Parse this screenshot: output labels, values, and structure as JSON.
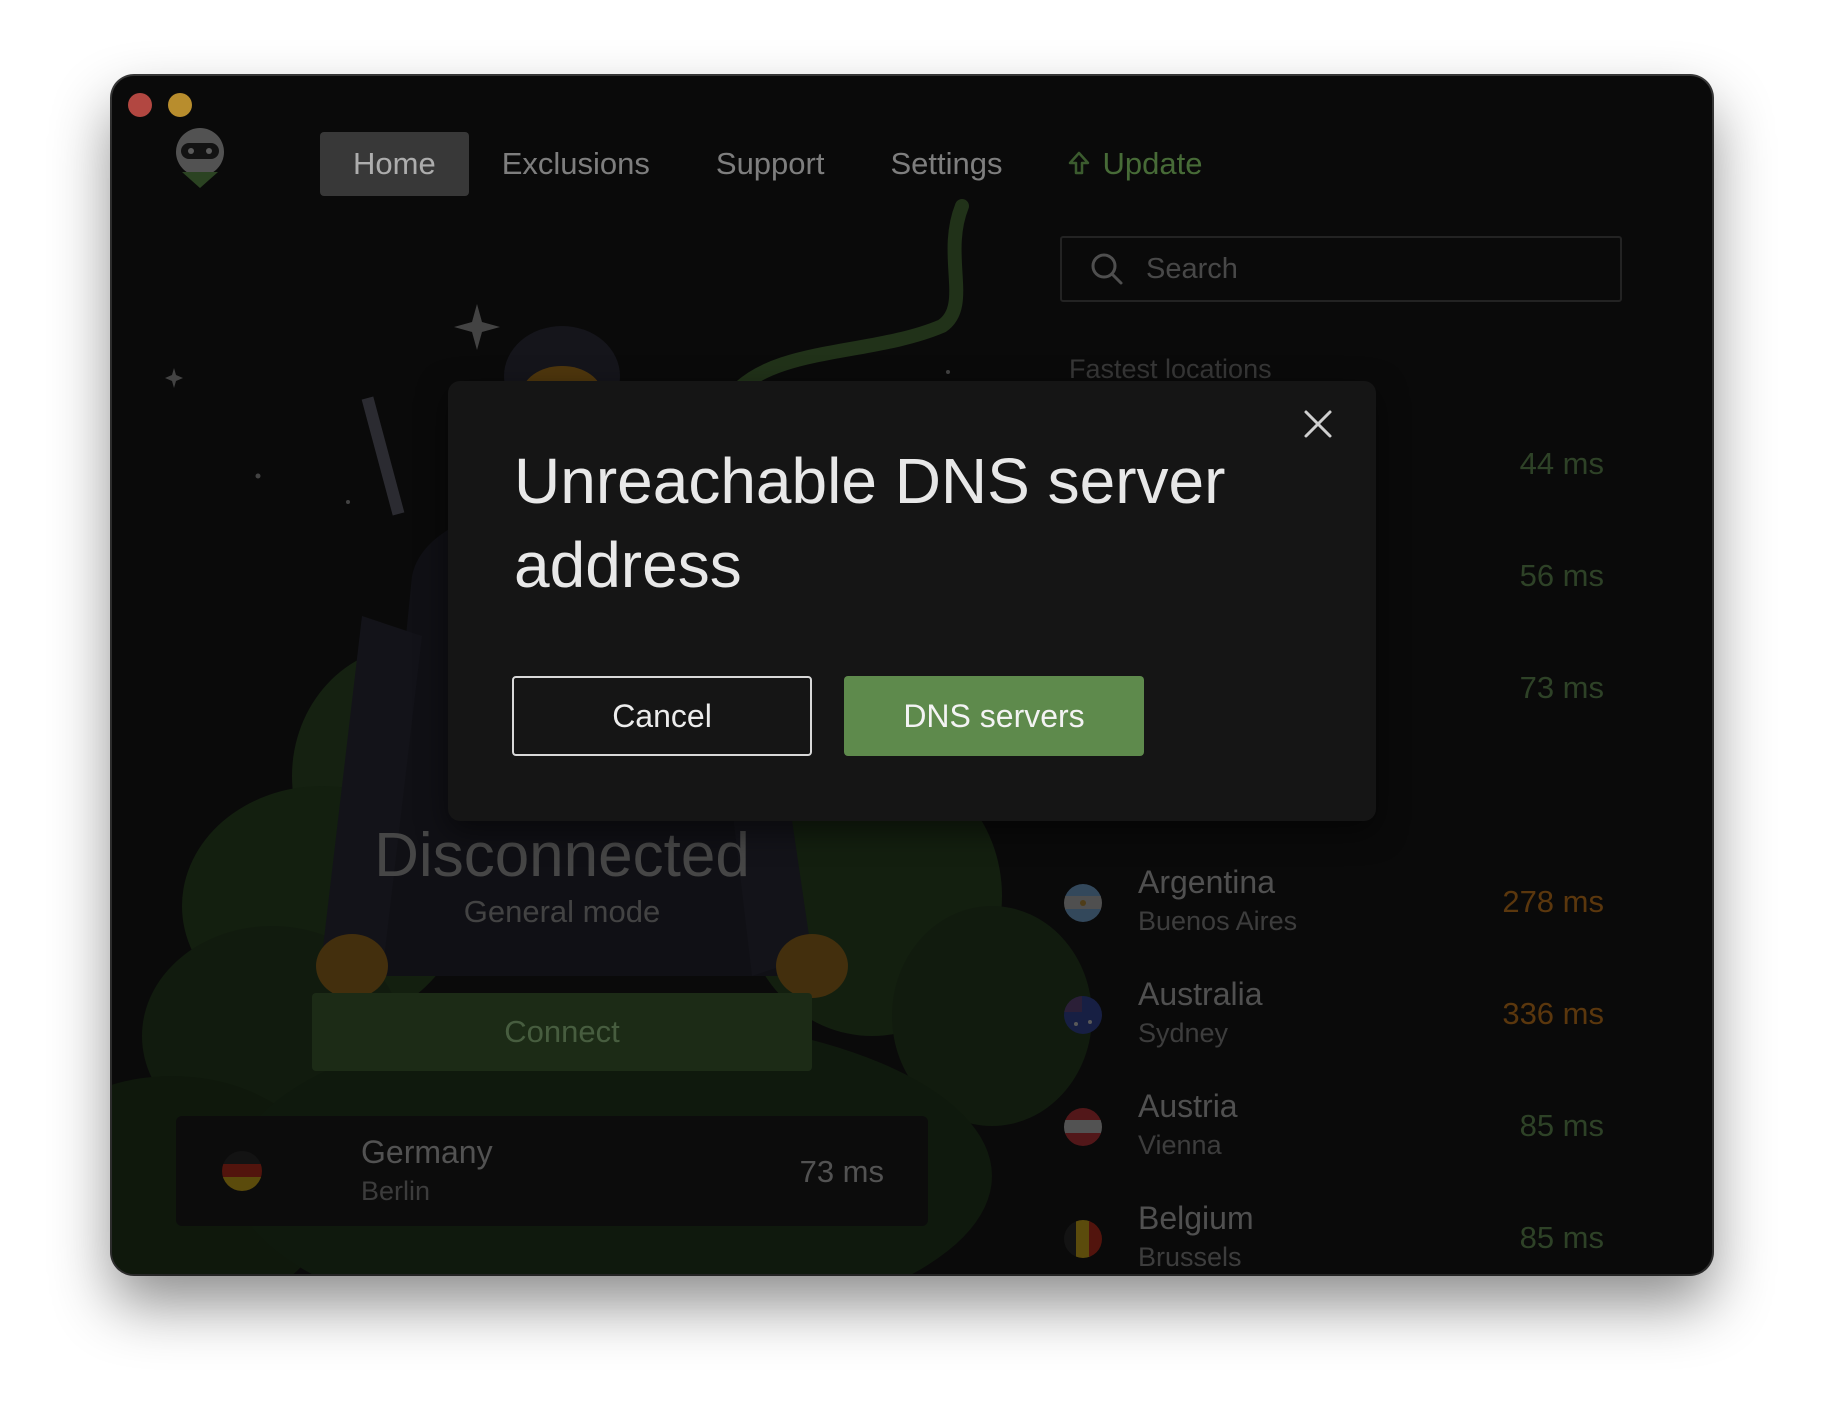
{
  "nav": {
    "home": "Home",
    "exclusions": "Exclusions",
    "support": "Support",
    "settings": "Settings",
    "update": "Update"
  },
  "status": {
    "title": "Disconnected",
    "mode": "General mode",
    "connect_label": "Connect"
  },
  "current_location": {
    "country": "Germany",
    "city": "Berlin",
    "ping": "73 ms",
    "flag": "germany-flag"
  },
  "search": {
    "placeholder": "Search"
  },
  "locations_section": {
    "label": "Fastest locations",
    "fastest_pings": [
      "44 ms",
      "56 ms",
      "73 ms"
    ]
  },
  "locations": [
    {
      "country": "Argentina",
      "city": "Buenos Aires",
      "ping": "278 ms",
      "ping_color": "#7a4a12"
    },
    {
      "country": "Australia",
      "city": "Sydney",
      "ping": "336 ms",
      "ping_color": "#7a4a12"
    },
    {
      "country": "Austria",
      "city": "Vienna",
      "ping": "85 ms",
      "ping_color": "#3e5834"
    },
    {
      "country": "Belgium",
      "city": "Brussels",
      "ping": "85 ms",
      "ping_color": "#3e5834"
    }
  ],
  "modal": {
    "title": "Unreachable DNS server address",
    "cancel_label": "Cancel",
    "primary_label": "DNS servers"
  },
  "colors": {
    "accent": "#5e8a4c",
    "window_bg": "#0e0e0e",
    "modal_bg": "#151515"
  }
}
